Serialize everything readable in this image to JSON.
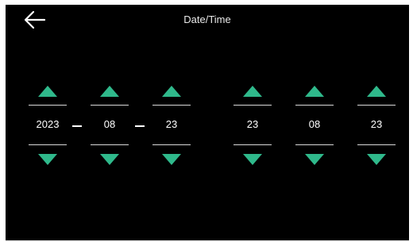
{
  "header": {
    "title": "Date/Time",
    "back_icon": "arrow-left-icon"
  },
  "date": {
    "year": "2023",
    "month": "08",
    "day": "23"
  },
  "time": {
    "hour": "23",
    "minute": "08",
    "second": "23"
  },
  "icons": {
    "increment": "triangle-up-icon",
    "decrement": "triangle-down-icon"
  },
  "colors": {
    "background": "#000000",
    "accent": "#2fb98b",
    "text": "#ffffff"
  }
}
